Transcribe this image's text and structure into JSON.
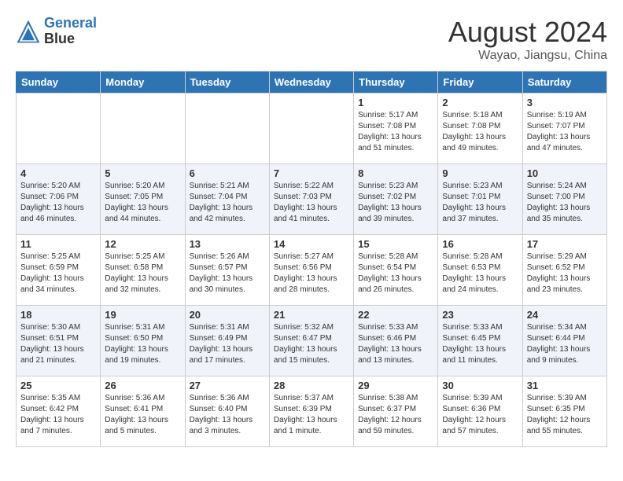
{
  "header": {
    "logo_line1": "General",
    "logo_line2": "Blue",
    "month_year": "August 2024",
    "location": "Wayao, Jiangsu, China"
  },
  "days_of_week": [
    "Sunday",
    "Monday",
    "Tuesday",
    "Wednesday",
    "Thursday",
    "Friday",
    "Saturday"
  ],
  "weeks": [
    [
      {
        "day": "",
        "info": ""
      },
      {
        "day": "",
        "info": ""
      },
      {
        "day": "",
        "info": ""
      },
      {
        "day": "",
        "info": ""
      },
      {
        "day": "1",
        "info": "Sunrise: 5:17 AM\nSunset: 7:08 PM\nDaylight: 13 hours\nand 51 minutes."
      },
      {
        "day": "2",
        "info": "Sunrise: 5:18 AM\nSunset: 7:08 PM\nDaylight: 13 hours\nand 49 minutes."
      },
      {
        "day": "3",
        "info": "Sunrise: 5:19 AM\nSunset: 7:07 PM\nDaylight: 13 hours\nand 47 minutes."
      }
    ],
    [
      {
        "day": "4",
        "info": "Sunrise: 5:20 AM\nSunset: 7:06 PM\nDaylight: 13 hours\nand 46 minutes."
      },
      {
        "day": "5",
        "info": "Sunrise: 5:20 AM\nSunset: 7:05 PM\nDaylight: 13 hours\nand 44 minutes."
      },
      {
        "day": "6",
        "info": "Sunrise: 5:21 AM\nSunset: 7:04 PM\nDaylight: 13 hours\nand 42 minutes."
      },
      {
        "day": "7",
        "info": "Sunrise: 5:22 AM\nSunset: 7:03 PM\nDaylight: 13 hours\nand 41 minutes."
      },
      {
        "day": "8",
        "info": "Sunrise: 5:23 AM\nSunset: 7:02 PM\nDaylight: 13 hours\nand 39 minutes."
      },
      {
        "day": "9",
        "info": "Sunrise: 5:23 AM\nSunset: 7:01 PM\nDaylight: 13 hours\nand 37 minutes."
      },
      {
        "day": "10",
        "info": "Sunrise: 5:24 AM\nSunset: 7:00 PM\nDaylight: 13 hours\nand 35 minutes."
      }
    ],
    [
      {
        "day": "11",
        "info": "Sunrise: 5:25 AM\nSunset: 6:59 PM\nDaylight: 13 hours\nand 34 minutes."
      },
      {
        "day": "12",
        "info": "Sunrise: 5:25 AM\nSunset: 6:58 PM\nDaylight: 13 hours\nand 32 minutes."
      },
      {
        "day": "13",
        "info": "Sunrise: 5:26 AM\nSunset: 6:57 PM\nDaylight: 13 hours\nand 30 minutes."
      },
      {
        "day": "14",
        "info": "Sunrise: 5:27 AM\nSunset: 6:56 PM\nDaylight: 13 hours\nand 28 minutes."
      },
      {
        "day": "15",
        "info": "Sunrise: 5:28 AM\nSunset: 6:54 PM\nDaylight: 13 hours\nand 26 minutes."
      },
      {
        "day": "16",
        "info": "Sunrise: 5:28 AM\nSunset: 6:53 PM\nDaylight: 13 hours\nand 24 minutes."
      },
      {
        "day": "17",
        "info": "Sunrise: 5:29 AM\nSunset: 6:52 PM\nDaylight: 13 hours\nand 23 minutes."
      }
    ],
    [
      {
        "day": "18",
        "info": "Sunrise: 5:30 AM\nSunset: 6:51 PM\nDaylight: 13 hours\nand 21 minutes."
      },
      {
        "day": "19",
        "info": "Sunrise: 5:31 AM\nSunset: 6:50 PM\nDaylight: 13 hours\nand 19 minutes."
      },
      {
        "day": "20",
        "info": "Sunrise: 5:31 AM\nSunset: 6:49 PM\nDaylight: 13 hours\nand 17 minutes."
      },
      {
        "day": "21",
        "info": "Sunrise: 5:32 AM\nSunset: 6:47 PM\nDaylight: 13 hours\nand 15 minutes."
      },
      {
        "day": "22",
        "info": "Sunrise: 5:33 AM\nSunset: 6:46 PM\nDaylight: 13 hours\nand 13 minutes."
      },
      {
        "day": "23",
        "info": "Sunrise: 5:33 AM\nSunset: 6:45 PM\nDaylight: 13 hours\nand 11 minutes."
      },
      {
        "day": "24",
        "info": "Sunrise: 5:34 AM\nSunset: 6:44 PM\nDaylight: 13 hours\nand 9 minutes."
      }
    ],
    [
      {
        "day": "25",
        "info": "Sunrise: 5:35 AM\nSunset: 6:42 PM\nDaylight: 13 hours\nand 7 minutes."
      },
      {
        "day": "26",
        "info": "Sunrise: 5:36 AM\nSunset: 6:41 PM\nDaylight: 13 hours\nand 5 minutes."
      },
      {
        "day": "27",
        "info": "Sunrise: 5:36 AM\nSunset: 6:40 PM\nDaylight: 13 hours\nand 3 minutes."
      },
      {
        "day": "28",
        "info": "Sunrise: 5:37 AM\nSunset: 6:39 PM\nDaylight: 13 hours\nand 1 minute."
      },
      {
        "day": "29",
        "info": "Sunrise: 5:38 AM\nSunset: 6:37 PM\nDaylight: 12 hours\nand 59 minutes."
      },
      {
        "day": "30",
        "info": "Sunrise: 5:39 AM\nSunset: 6:36 PM\nDaylight: 12 hours\nand 57 minutes."
      },
      {
        "day": "31",
        "info": "Sunrise: 5:39 AM\nSunset: 6:35 PM\nDaylight: 12 hours\nand 55 minutes."
      }
    ]
  ]
}
